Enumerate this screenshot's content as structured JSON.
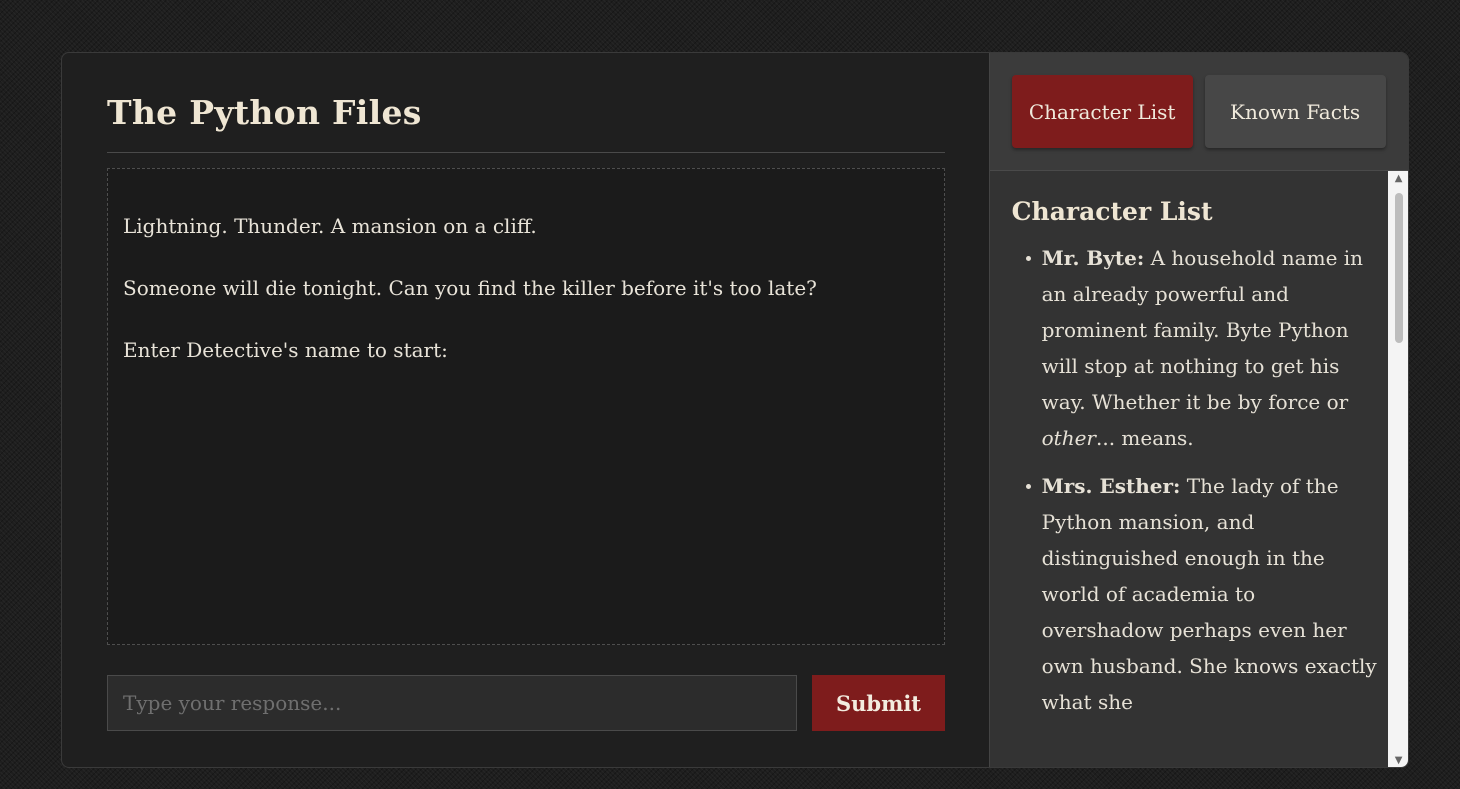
{
  "app": {
    "title": "The Python Files"
  },
  "story": {
    "lines": [
      "Lightning. Thunder. A mansion on a cliff.",
      "Someone will die tonight. Can you find the killer before it's too late?",
      "Enter Detective's name to start:"
    ]
  },
  "input": {
    "placeholder": "Type your response...",
    "value": ""
  },
  "submit": {
    "label": "Submit"
  },
  "tabs": [
    {
      "label": "Character List",
      "active": true
    },
    {
      "label": "Known Facts",
      "active": false
    }
  ],
  "sidebar": {
    "heading": "Character List",
    "characters": [
      {
        "name": "Mr. Byte:",
        "desc_before": " A household name in an already powerful and prominent family. Byte Python will stop at nothing to get his way. Whether it be by force or ",
        "desc_em": "other",
        "desc_after": "... means."
      },
      {
        "name": "Mrs. Esther:",
        "desc_before": " The lady of the Python mansion, and distinguished enough in the world of academia to overshadow perhaps even her own husband. She knows exactly what she",
        "desc_em": "",
        "desc_after": ""
      }
    ]
  },
  "colors": {
    "accent": "#7e1c1c",
    "panel": "#1f1f1f",
    "sidebar": "#333333",
    "text": "#e8e3d8"
  },
  "icons": {
    "scroll_up": "chevron-up-icon",
    "scroll_down": "chevron-down-icon"
  }
}
